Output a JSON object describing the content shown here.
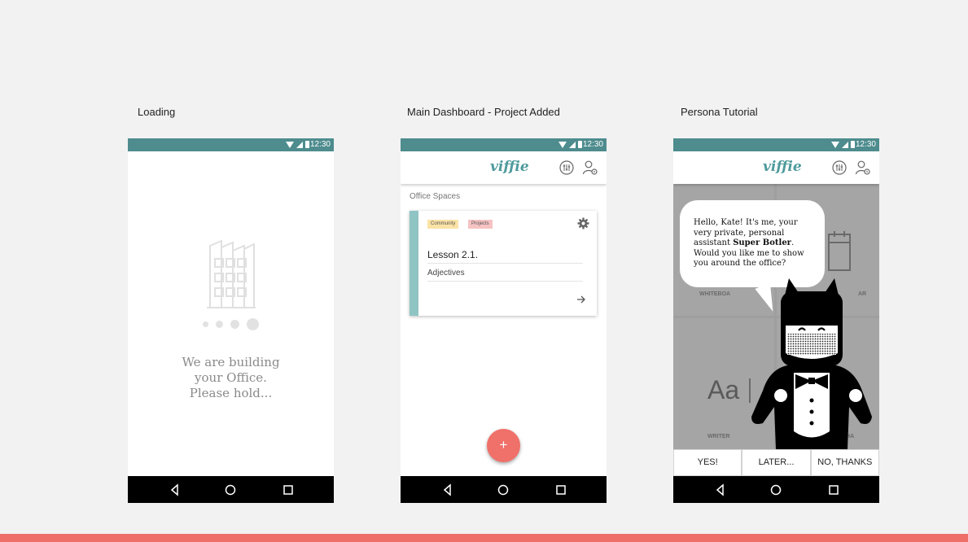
{
  "screens": {
    "loading": {
      "title": "Loading"
    },
    "dashboard": {
      "title": "Main Dashboard - Project Added"
    },
    "tutorial": {
      "title": "Persona Tutorial"
    }
  },
  "status_bar": {
    "time": "12:30",
    "color": "#4e8c8e"
  },
  "app_bar": {
    "logo": "viffie"
  },
  "loading": {
    "message": "We are building\nyour Office.\nPlease hold..."
  },
  "dashboard": {
    "section_label": "Office Spaces",
    "card": {
      "tags": [
        "Community",
        "Projects"
      ],
      "title": "Lesson 2.1.",
      "subtitle": "Adjectives"
    },
    "fab_label": "+"
  },
  "tutorial": {
    "speech": {
      "pre": "Hello, Kate! It's me, your very private, personal assistant ",
      "bold": "Super Botler",
      "post": ". Would you like me to show you around the office?"
    },
    "tiles": [
      "WHITEBOA",
      "AR",
      "WRITER",
      "CHA"
    ],
    "tile_glyph": "Aa",
    "buttons": [
      "YES!",
      "LATER...",
      "NO, THANKS"
    ]
  },
  "colors": {
    "accent": "#4e9a9c",
    "fab": "#f0706a",
    "footer": "#ee6e68"
  }
}
